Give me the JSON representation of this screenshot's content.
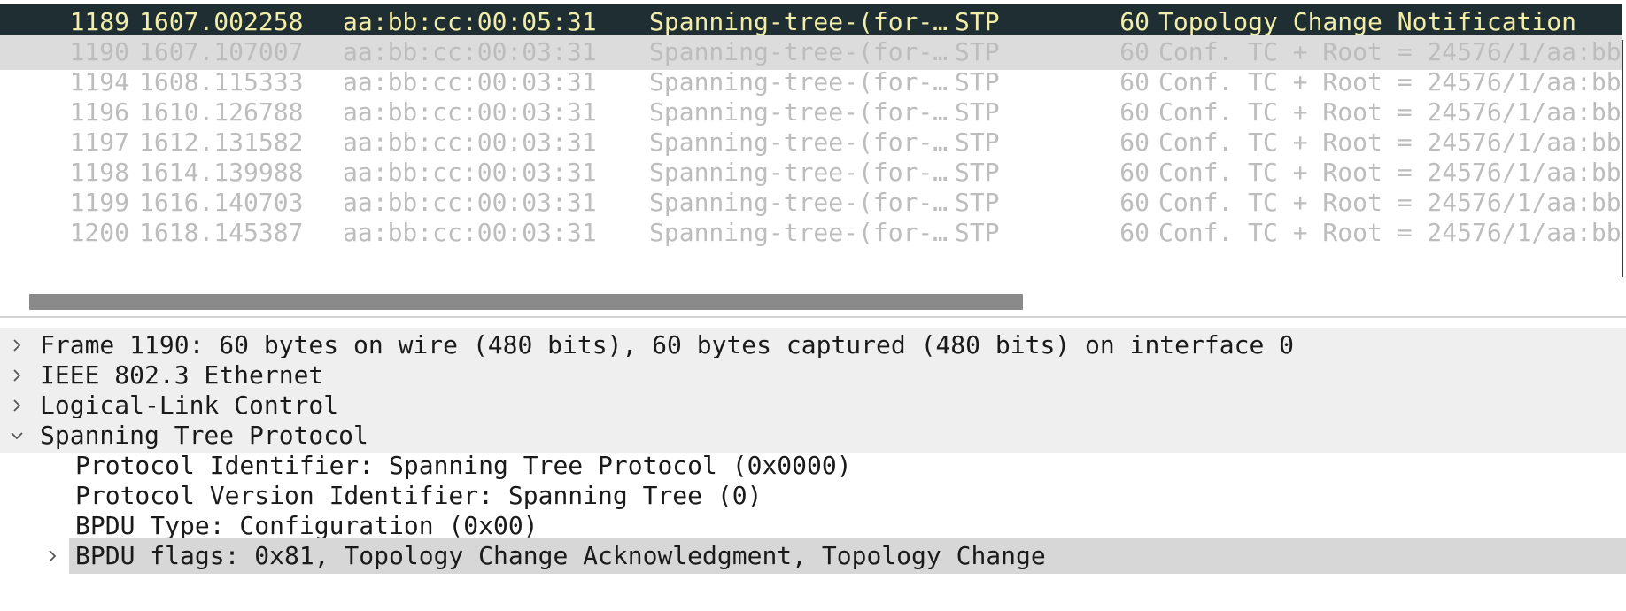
{
  "packet_list": {
    "rows": [
      {
        "no": "1189",
        "time": "1607.002258",
        "source": "aa:bb:cc:00:05:31",
        "destination": "Spanning-tree-(for-…",
        "protocol": "STP",
        "length": "60",
        "info": "Topology Change Notification",
        "state": "selected"
      },
      {
        "no": "1190",
        "time": "1607.107007",
        "source": "aa:bb:cc:00:03:31",
        "destination": "Spanning-tree-(for-…",
        "protocol": "STP",
        "length": "60",
        "info": "Conf. TC + Root = 24576/1/aa:bb:",
        "state": "hovered"
      },
      {
        "no": "1194",
        "time": "1608.115333",
        "source": "aa:bb:cc:00:03:31",
        "destination": "Spanning-tree-(for-…",
        "protocol": "STP",
        "length": "60",
        "info": "Conf. TC + Root = 24576/1/aa:bb:",
        "state": "normal"
      },
      {
        "no": "1196",
        "time": "1610.126788",
        "source": "aa:bb:cc:00:03:31",
        "destination": "Spanning-tree-(for-…",
        "protocol": "STP",
        "length": "60",
        "info": "Conf. TC + Root = 24576/1/aa:bb:",
        "state": "normal"
      },
      {
        "no": "1197",
        "time": "1612.131582",
        "source": "aa:bb:cc:00:03:31",
        "destination": "Spanning-tree-(for-…",
        "protocol": "STP",
        "length": "60",
        "info": "Conf. TC + Root = 24576/1/aa:bb:",
        "state": "normal"
      },
      {
        "no": "1198",
        "time": "1614.139988",
        "source": "aa:bb:cc:00:03:31",
        "destination": "Spanning-tree-(for-…",
        "protocol": "STP",
        "length": "60",
        "info": "Conf. TC + Root = 24576/1/aa:bb:",
        "state": "normal"
      },
      {
        "no": "1199",
        "time": "1616.140703",
        "source": "aa:bb:cc:00:03:31",
        "destination": "Spanning-tree-(for-…",
        "protocol": "STP",
        "length": "60",
        "info": "Conf. TC + Root = 24576/1/aa:bb:",
        "state": "normal"
      },
      {
        "no": "1200",
        "time": "1618.145387",
        "source": "aa:bb:cc:00:03:31",
        "destination": "Spanning-tree-(for-…",
        "protocol": "STP",
        "length": "60",
        "info": "Conf. TC + Root = 24576/1/aa:bb:",
        "state": "normal"
      }
    ]
  },
  "details_tree": {
    "items": [
      {
        "label": "Frame 1190: 60 bytes on wire (480 bits), 60 bytes captured (480 bits) on interface 0",
        "level": 0,
        "expander": "chevron-right-icon",
        "style": "top"
      },
      {
        "label": "IEEE 802.3 Ethernet",
        "level": 0,
        "expander": "chevron-right-icon",
        "style": "top"
      },
      {
        "label": "Logical-Link Control",
        "level": 0,
        "expander": "chevron-right-icon",
        "style": "top"
      },
      {
        "label": "Spanning Tree Protocol",
        "level": 0,
        "expander": "chevron-down-icon",
        "style": "top"
      },
      {
        "label": "Protocol Identifier: Spanning Tree Protocol (0x0000)",
        "level": 1,
        "expander": "",
        "style": "plain"
      },
      {
        "label": "Protocol Version Identifier: Spanning Tree (0)",
        "level": 1,
        "expander": "",
        "style": "plain"
      },
      {
        "label": "BPDU Type: Configuration (0x00)",
        "level": 1,
        "expander": "",
        "style": "plain"
      },
      {
        "label": "BPDU flags: 0x81, Topology Change Acknowledgment, Topology Change",
        "level": 1,
        "expander": "chevron-right-icon",
        "style": "highlighted"
      }
    ]
  },
  "colors": {
    "selected_row_bg": "#1e2e33",
    "selected_row_fg": "#f2eda8",
    "hovered_row_bg": "#dcdcdc",
    "dim_text": "#bdbdbd",
    "tree_text": "#1a1a1a",
    "scroll_thumb": "#8a8a8a"
  }
}
